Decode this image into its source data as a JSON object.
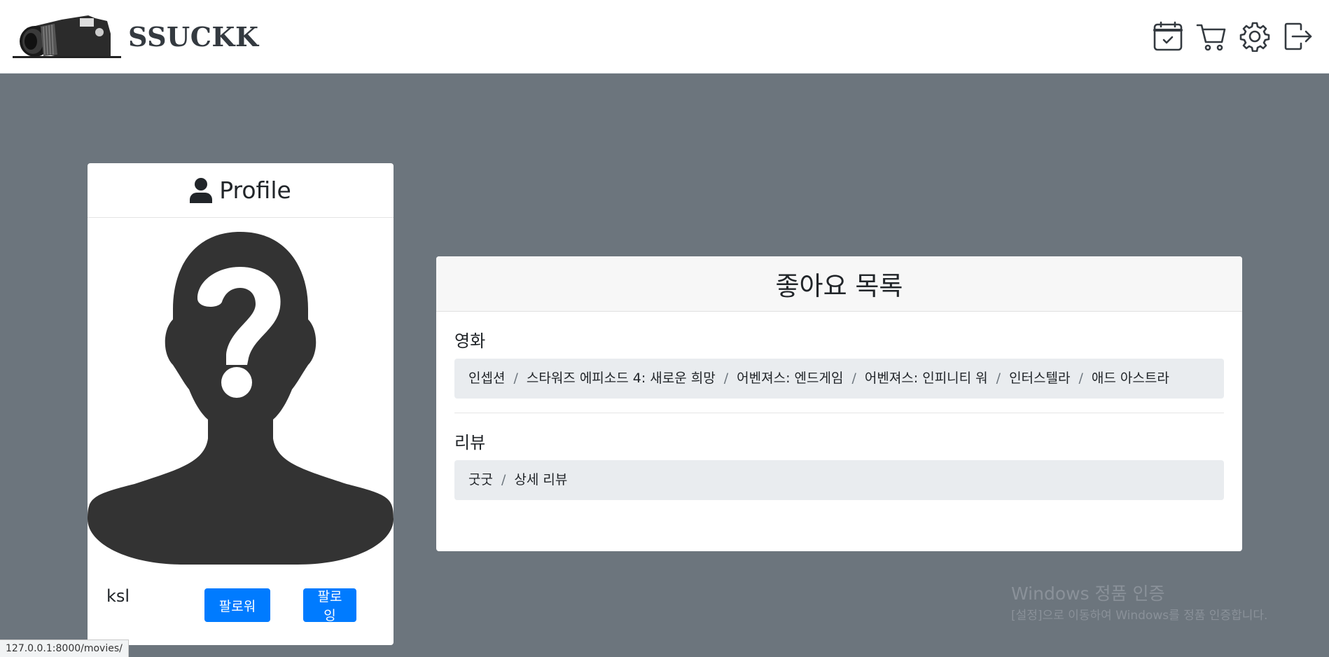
{
  "brand": {
    "name": "SSUCKK"
  },
  "nav": {
    "icons": [
      "calendar-check-icon",
      "cart-icon",
      "gear-icon",
      "logout-icon"
    ]
  },
  "profile": {
    "title": "Profile",
    "username": "ksl",
    "follower_label": "팔로워",
    "following_label": "팔로잉"
  },
  "likes": {
    "title": "좋아요 목록",
    "movies_title": "영화",
    "movies": [
      "인셉션",
      "스타워즈 에피소드 4: 새로운 희망",
      "어벤져스: 엔드게임",
      "어벤져스: 인피니티 워",
      "인터스텔라",
      "애드 아스트라"
    ],
    "reviews_title": "리뷰",
    "reviews": [
      "굿굿",
      "상세 리뷰"
    ]
  },
  "watermark": {
    "title": "Windows 정품 인증",
    "subtitle": "[설정]으로 이동하여 Windows를 정품 인증합니다."
  },
  "status_bar": {
    "url": "127.0.0.1:8000/movies/"
  },
  "colors": {
    "page_bg": "#6c757d",
    "primary": "#007bff",
    "breadcrumb_bg": "#e9ecef",
    "avatar": "#333333"
  }
}
